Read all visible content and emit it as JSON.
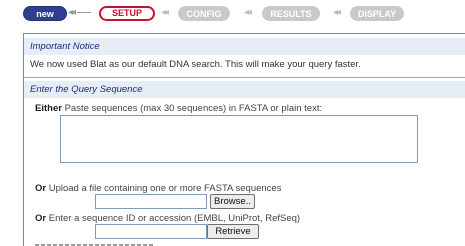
{
  "nav": {
    "new_label": "new",
    "steps": [
      {
        "label": "SETUP",
        "state": "active"
      },
      {
        "label": "CONFIG",
        "state": "disabled"
      },
      {
        "label": "RESULTS",
        "state": "disabled"
      },
      {
        "label": "DISPLAY",
        "state": "disabled"
      }
    ],
    "arrow_glyph": "◂◂"
  },
  "notice": {
    "title": "Important Notice",
    "text": "We now used Blat as our default DNA search. This will make your query faster."
  },
  "query": {
    "title": "Enter the Query Sequence",
    "either_prefix": "Either",
    "either_text": "Paste sequences (max 30 sequences) in FASTA or plain text:",
    "or_prefix": "Or",
    "upload_text": "Upload a file containing one or more FASTA sequences",
    "browse_label": "Browse..",
    "enter_text": "Enter a sequence ID or accession (EMBL, UniProt, RefSeq)",
    "retrieve_label": "Retrieve"
  },
  "colors": {
    "accent_active": "#c8102e",
    "nav_new": "#2f3f8f",
    "section_bg": "#e7edf7",
    "section_title": "#1b2c7a",
    "disabled": "#c9c9c9"
  }
}
